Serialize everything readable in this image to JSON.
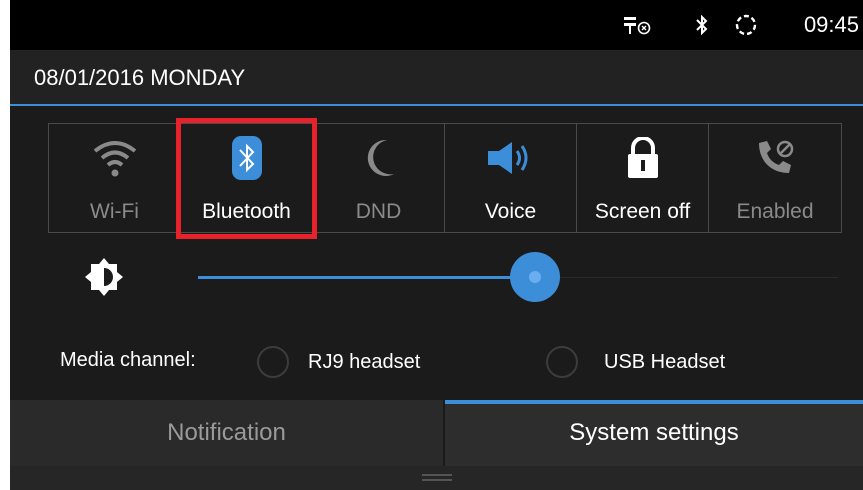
{
  "status_bar": {
    "icons": [
      "usb-debug-icon",
      "bluetooth-icon",
      "sync-icon"
    ],
    "time": "09:45"
  },
  "header": {
    "date": "08/01/2016 MONDAY"
  },
  "quick_tiles": [
    {
      "label": "Wi-Fi",
      "icon": "wifi-icon",
      "active": false
    },
    {
      "label": "Bluetooth",
      "icon": "bluetooth-icon",
      "active": true
    },
    {
      "label": "DND",
      "icon": "moon-icon",
      "active": false
    },
    {
      "label": "Voice",
      "icon": "speaker-icon",
      "active": true
    },
    {
      "label": "Screen off",
      "icon": "lock-icon",
      "active": true
    },
    {
      "label": "Enabled",
      "icon": "phone-icon",
      "active": false
    }
  ],
  "brightness": {
    "icon": "brightness-icon",
    "level": 0.59
  },
  "media_channel": {
    "label": "Media channel:",
    "options": [
      {
        "label": "RJ9 headset",
        "selected": false
      },
      {
        "label": "USB Headset",
        "selected": false
      }
    ]
  },
  "tabs": [
    {
      "label": "Notification",
      "active": false
    },
    {
      "label": "System settings",
      "active": true
    }
  ],
  "colors": {
    "accent": "#3d8ed8",
    "highlight": "#e8222a",
    "background": "#1b1b1b"
  }
}
